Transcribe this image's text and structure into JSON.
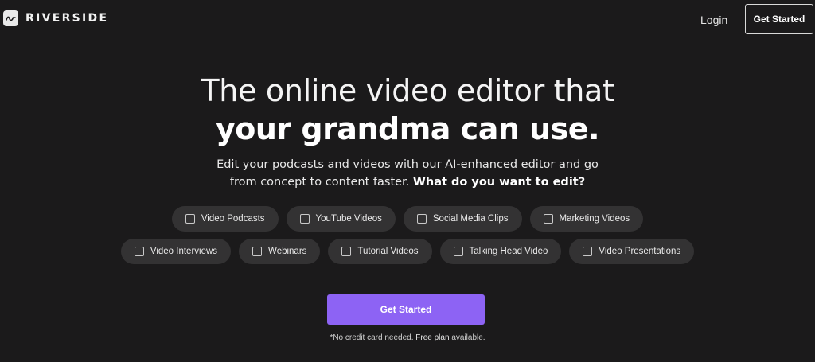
{
  "header": {
    "brand": "RIVERSIDE",
    "login_label": "Login",
    "cta_label": "Get Started"
  },
  "hero": {
    "headline_line1": "The online video editor that",
    "headline_line2": "your grandma can use.",
    "subtext_line1": "Edit your podcasts and videos with our AI-enhanced editor and go",
    "subtext_line2": "from concept to content faster.",
    "subtext_question": "What do you want to edit?"
  },
  "options": {
    "row1": [
      "Video Podcasts",
      "YouTube Videos",
      "Social Media Clips",
      "Marketing Videos"
    ],
    "row2": [
      "Video Interviews",
      "Webinars",
      "Tutorial Videos",
      "Talking Head Video",
      "Video Presentations"
    ]
  },
  "cta": {
    "label": "Get Started",
    "note_prefix": "*No credit card needed.",
    "note_link": "Free plan",
    "note_suffix": "available."
  },
  "colors": {
    "background": "#1b1a1b",
    "chip": "#333233",
    "accent": "#8d63f4"
  },
  "icons": {
    "logo": "waveform-logo-icon",
    "checkbox": "checkbox-icon"
  }
}
